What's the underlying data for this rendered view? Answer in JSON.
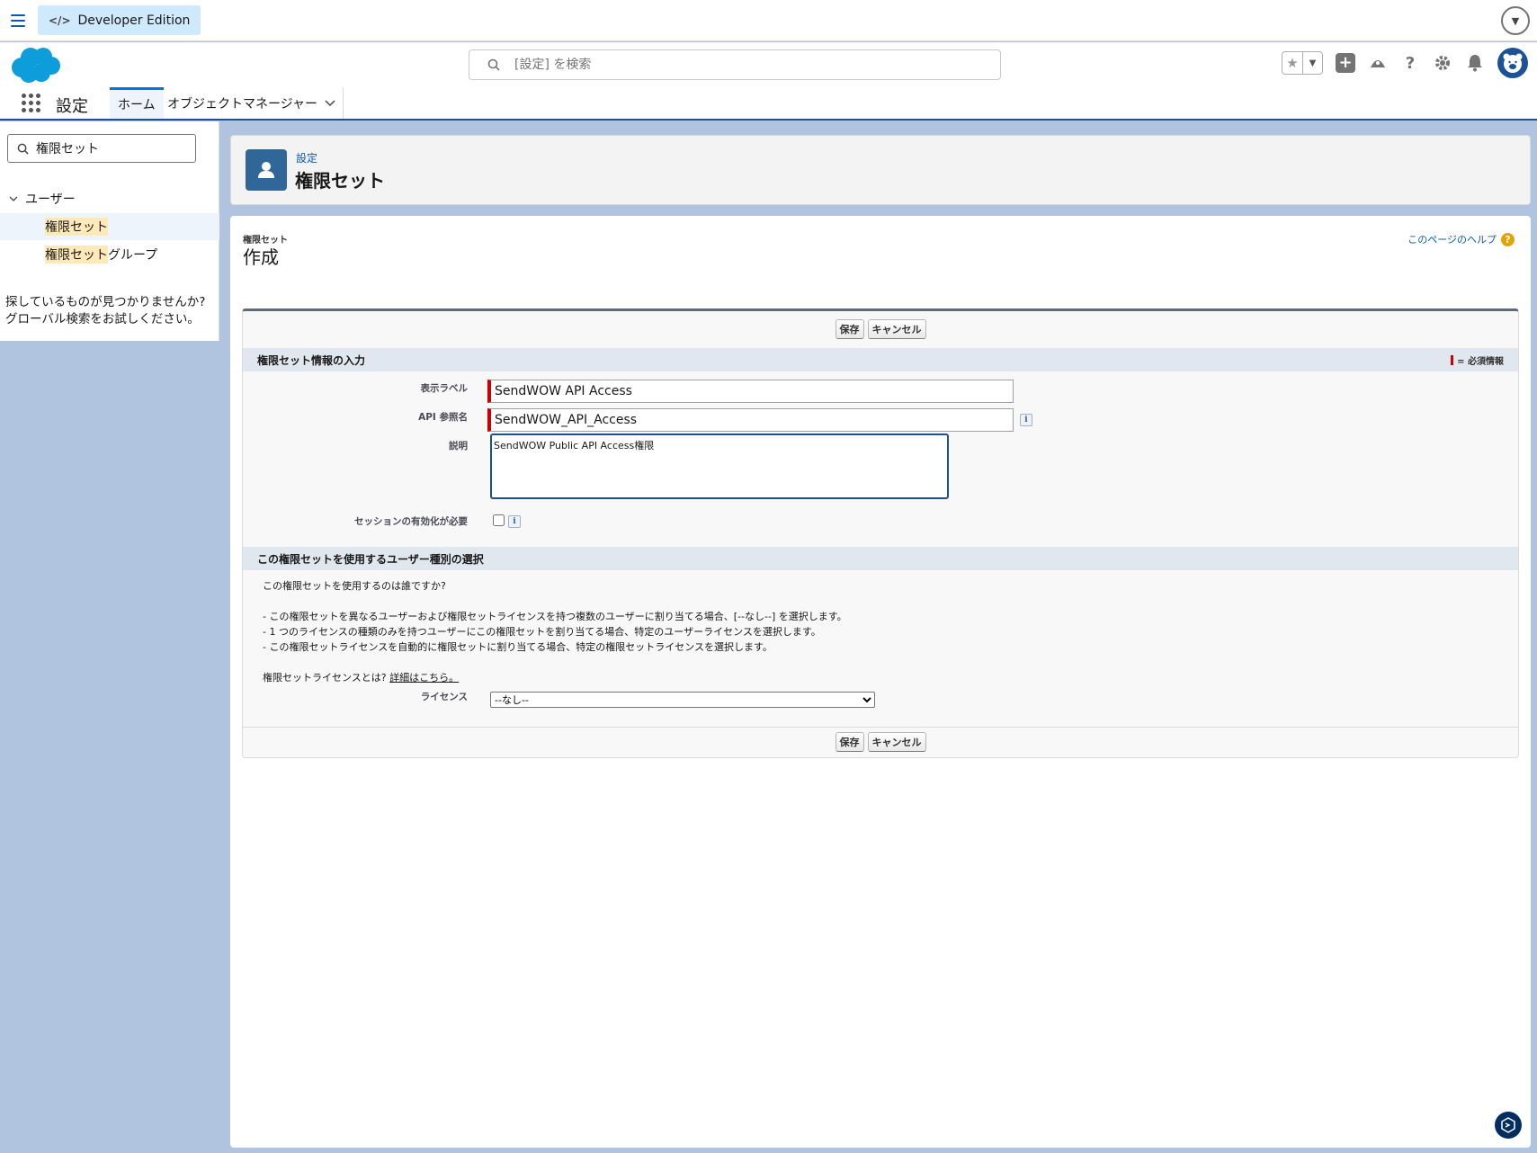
{
  "topbar": {
    "edition_label": "Developer Edition",
    "menu_icon": "hamburger-icon",
    "dropdown_icon": "chevron-down-icon"
  },
  "header": {
    "search_placeholder": "[設定] を検索",
    "icons": [
      "favorites-star-icon",
      "add-icon",
      "trailhead-icon",
      "help-icon",
      "gear-icon",
      "bell-icon",
      "avatar"
    ]
  },
  "nav": {
    "app_name": "設定",
    "tabs": [
      {
        "label": "ホーム"
      },
      {
        "label": "オブジェクトマネージャー"
      }
    ]
  },
  "sidebar": {
    "search_value": "権限セット",
    "group_label": "ユーザー",
    "items": [
      {
        "highlight": "権限セット",
        "rest": ""
      },
      {
        "highlight": "権限セット",
        "rest": "グループ"
      }
    ],
    "help_line1": "探しているものが見つかりませんか?",
    "help_line2": "グローバル検索をお試しください。"
  },
  "page_header": {
    "breadcrumb": "設定",
    "title": "権限セット"
  },
  "main": {
    "breadcrumb": "権限セット",
    "title": "作成",
    "help_link": "このページのヘルプ",
    "buttons": {
      "save": "保存",
      "cancel": "キャンセル"
    },
    "section1": {
      "title": "権限セット情報の入力",
      "required_legend": "= 必須情報",
      "label_field_label": "表示ラベル",
      "label_field_value": "SendWOW API Access",
      "api_name_label": "API 参照名",
      "api_name_value": "SendWOW_API_Access",
      "description_label": "説明",
      "description_value": "SendWOW Public API Access権限",
      "session_label": "セッションの有効化が必要"
    },
    "section2": {
      "title": "この権限セットを使用するユーザー種別の選択",
      "question": "この権限セットを使用するのは誰ですか?",
      "bullet1": "- この権限セットを異なるユーザーおよび権限セットライセンスを持つ複数のユーザーに割り当てる場合、[--なし--] を選択します。",
      "bullet2": "- 1 つのライセンスの種類のみを持つユーザーにこの権限セットを割り当てる場合、特定のユーザーライセンスを選択します。",
      "bullet3": "- この権限セットライセンスを自動的に権限セットに割り当てる場合、特定の権限セットライセンスを選択します。",
      "license_question": "権限セットライセンスとは?",
      "details_link": "詳細はこちら。",
      "license_label": "ライセンス",
      "license_value": "--なし--"
    }
  }
}
